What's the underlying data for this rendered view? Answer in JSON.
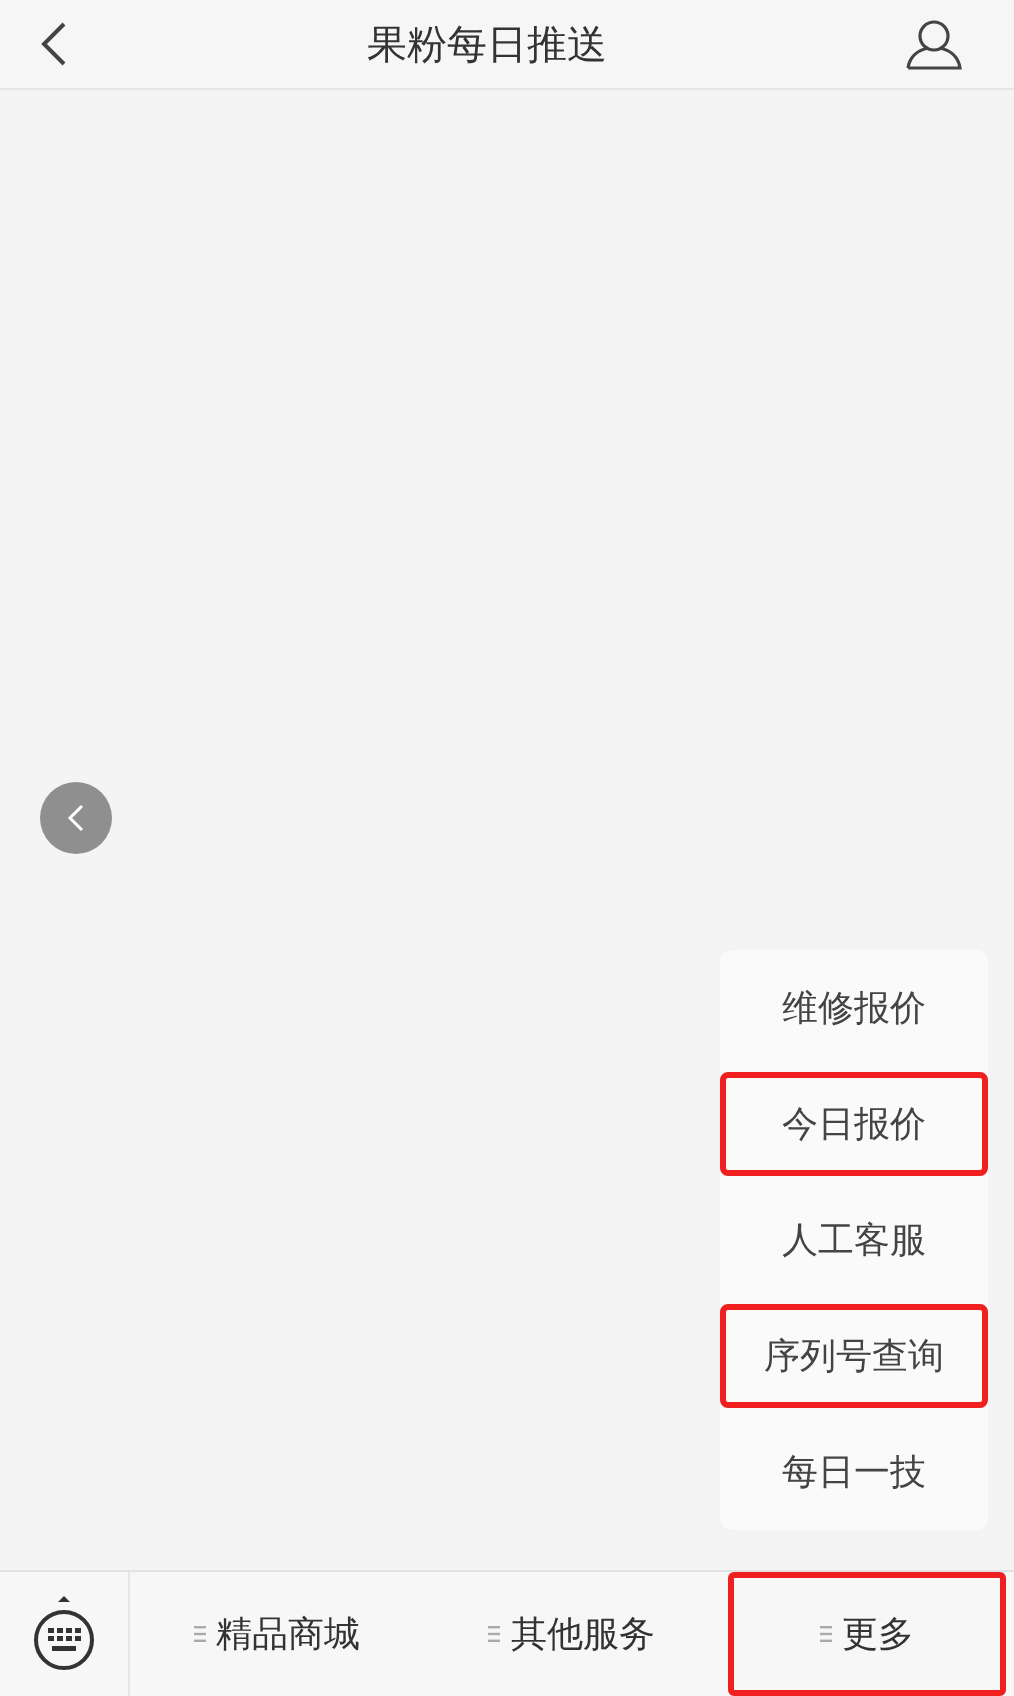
{
  "header": {
    "title": "果粉每日推送"
  },
  "menu": {
    "items": [
      {
        "label": "维修报价",
        "highlighted": false
      },
      {
        "label": "今日报价",
        "highlighted": true
      },
      {
        "label": "人工客服",
        "highlighted": false
      },
      {
        "label": "序列号查询",
        "highlighted": true
      },
      {
        "label": "每日一技",
        "highlighted": false
      }
    ]
  },
  "bottom_bar": {
    "items": [
      {
        "label": "精品商城",
        "highlighted": false
      },
      {
        "label": "其他服务",
        "highlighted": false
      },
      {
        "label": "更多",
        "highlighted": true
      }
    ]
  }
}
